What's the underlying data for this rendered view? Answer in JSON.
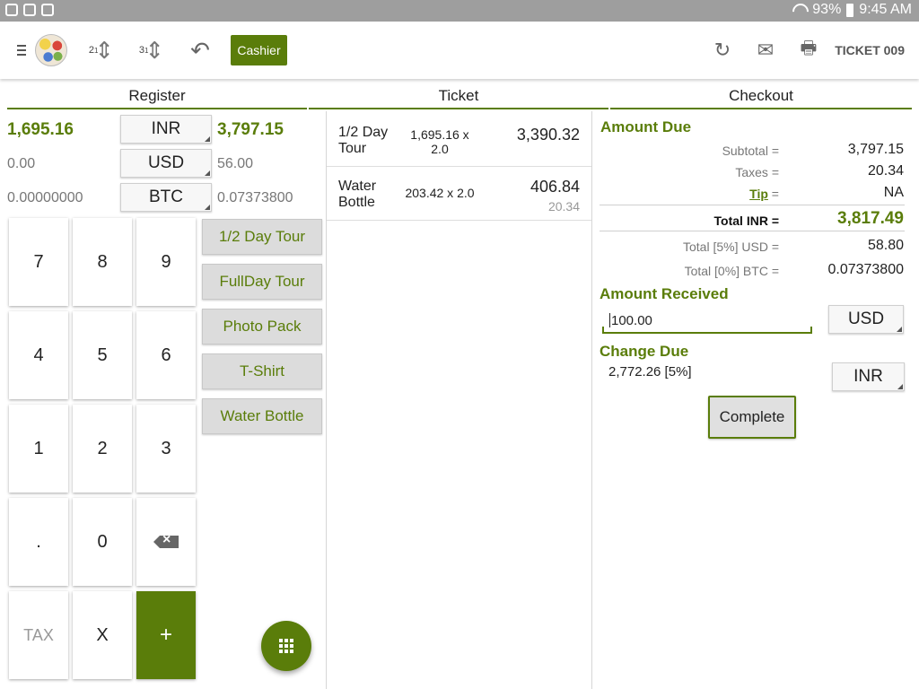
{
  "status_bar": {
    "battery": "93%",
    "time": "9:45 AM"
  },
  "toolbar": {
    "sort_a_label": "2",
    "sort_a_sub": "1",
    "sort_b_label": "3",
    "sort_b_sub": "1",
    "cashier_label": "Cashier",
    "ticket_label": "TICKET 009"
  },
  "sections": {
    "register": "Register",
    "ticket": "Ticket",
    "checkout": "Checkout"
  },
  "register": {
    "rows": [
      {
        "amount": "1,695.16",
        "currency": "INR",
        "value": "3,797.15"
      },
      {
        "amount": "0.00",
        "currency": "USD",
        "value": "56.00"
      },
      {
        "amount": "0.00000000",
        "currency": "BTC",
        "value": "0.07373800"
      }
    ]
  },
  "keypad": {
    "k7": "7",
    "k8": "8",
    "k9": "9",
    "k4": "4",
    "k5": "5",
    "k6": "6",
    "k1": "1",
    "k2": "2",
    "k3": "3",
    "kdot": ".",
    "k0": "0",
    "ktax": "TAX",
    "kx": "X",
    "kplus": "+"
  },
  "products": [
    "1/2 Day Tour",
    "FullDay Tour",
    "Photo Pack",
    "T-Shirt",
    "Water Bottle"
  ],
  "ticket": {
    "items": [
      {
        "name": "1/2 Day Tour",
        "qty": "1,695.16 x 2.0",
        "total": "3,390.32",
        "tax": ""
      },
      {
        "name": "Water Bottle",
        "qty": "203.42 x 2.0",
        "total": "406.84",
        "tax": "20.34"
      }
    ]
  },
  "checkout": {
    "amount_due_title": "Amount Due",
    "subtotal_label": "Subtotal =",
    "subtotal": "3,797.15",
    "taxes_label": "Taxes =",
    "taxes": "20.34",
    "tip_label": "Tip",
    "tip_eq": " =",
    "tip": "NA",
    "total_inr_label": "Total INR =",
    "total_inr": "3,817.49",
    "total_usd_label": "Total [5%] USD =",
    "total_usd": "58.80",
    "total_btc_label": "Total [0%] BTC =",
    "total_btc": "0.07373800",
    "amount_received_title": "Amount Received",
    "amount_received_value": "100.00",
    "received_currency": "USD",
    "change_due_title": "Change Due",
    "change_due_value": "2,772.26 [5%]",
    "change_currency": "INR",
    "complete_label": "Complete"
  },
  "colors": {
    "accent": "#5a7d0a",
    "status_bar": "#9e9e9e"
  }
}
